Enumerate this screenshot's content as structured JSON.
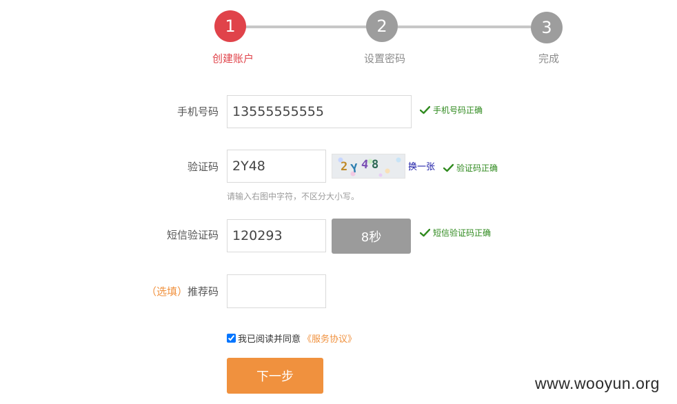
{
  "steps": [
    {
      "number": "1",
      "label": "创建账户",
      "state": "active"
    },
    {
      "number": "2",
      "label": "设置密码",
      "state": "pending"
    },
    {
      "number": "3",
      "label": "完成",
      "state": "pending"
    }
  ],
  "colors": {
    "active_step": "#e0434a",
    "pending_step": "#9d9d9d",
    "accent_orange": "#f0913e",
    "success_green": "#2f8a1e"
  },
  "form": {
    "phone": {
      "label": "手机号码",
      "value": "13555555555",
      "ok_text": "手机号码正确"
    },
    "captcha": {
      "label": "验证码",
      "value": "2Y48",
      "image_chars": [
        "2",
        "Y",
        "4",
        "8"
      ],
      "refresh_text": "换一张",
      "ok_text": "验证码正确",
      "hint": "请输入右图中字符，不区分大小写。"
    },
    "sms": {
      "label": "短信验证码",
      "value": "120293",
      "button_text": "8秒",
      "ok_text": "短信验证码正确"
    },
    "referral": {
      "optional_tag": "（选填）",
      "label": "推荐码",
      "value": ""
    },
    "agreement": {
      "checked": true,
      "text": "我已阅读并同意",
      "link_text": "《服务协议》"
    },
    "next_button": "下一步"
  },
  "watermark": "www.wooyun.org",
  "icons": {
    "ok": "checkmark-icon"
  }
}
